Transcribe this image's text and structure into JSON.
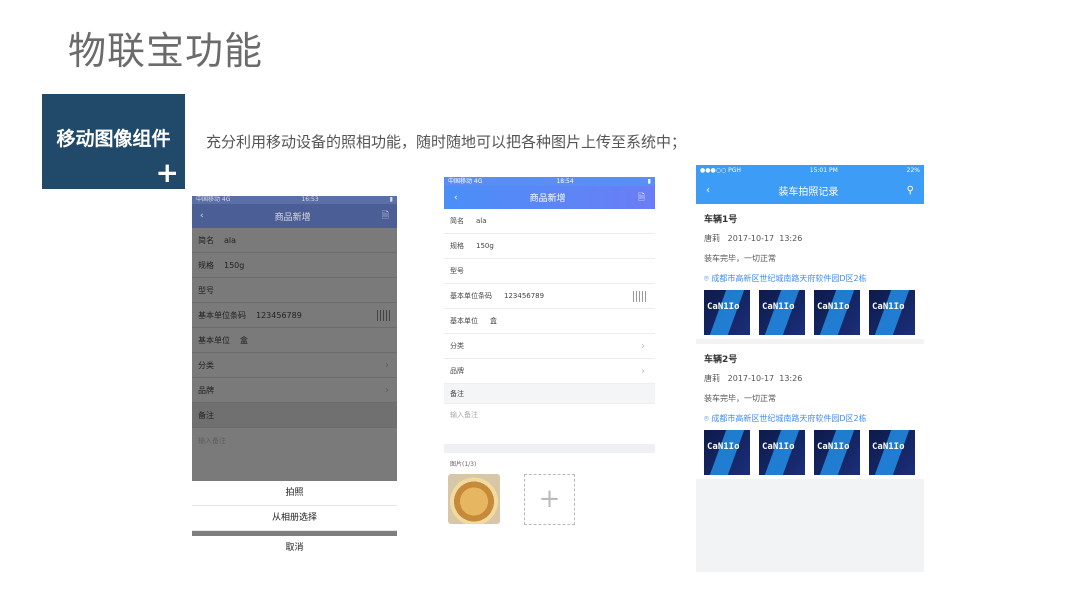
{
  "slide": {
    "title": "物联宝功能",
    "badge_label": "移动图像组件",
    "badge_plus": "+",
    "description": "充分利用移动设备的照相功能，随时随地可以把各种图片上传至系统中；"
  },
  "phone1": {
    "status": {
      "carrier": "中国移动 4G",
      "time": "16:53"
    },
    "nav": {
      "back": "‹",
      "title": "商品新增",
      "save": "🗎"
    },
    "rows": [
      {
        "label": "简名",
        "value": "ala"
      },
      {
        "label": "规格",
        "value": "150g"
      },
      {
        "label": "型号",
        "value": ""
      },
      {
        "label": "基本单位条码",
        "value": "123456789"
      },
      {
        "label": "基本单位",
        "value": "盒"
      },
      {
        "label": "分类",
        "value": ""
      },
      {
        "label": "品牌",
        "value": ""
      }
    ],
    "remark_label": "备注",
    "remark_placeholder": "输入备注",
    "sheet": {
      "camera": "拍照",
      "album": "从相册选择",
      "cancel": "取消"
    }
  },
  "phone2": {
    "status": {
      "carrier": "中国移动 4G",
      "time": "18:54"
    },
    "nav": {
      "back": "‹",
      "title": "商品新增",
      "save": "🗎"
    },
    "rows": [
      {
        "label": "简名",
        "value": "ala"
      },
      {
        "label": "规格",
        "value": "150g"
      },
      {
        "label": "型号",
        "value": ""
      },
      {
        "label": "基本单位条码",
        "value": "123456789"
      },
      {
        "label": "基本单位",
        "value": "盒"
      },
      {
        "label": "分类",
        "value": ""
      },
      {
        "label": "品牌",
        "value": ""
      }
    ],
    "remark_label": "备注",
    "remark_placeholder": "输入备注",
    "images_label": "图片(1/3)",
    "add_symbol": "+"
  },
  "phone3": {
    "status": {
      "carrier": "●●●○○ PGH",
      "time": "15:01 PM",
      "battery": "22%"
    },
    "nav": {
      "back": "‹",
      "title": "装车拍照记录",
      "filter": "⚲"
    },
    "records": [
      {
        "vehicle": "车辆1号",
        "person": "唐莉",
        "date": "2017-10-17",
        "time": "13:26",
        "note": "装车完毕，一切正常",
        "location": "成都市高新区世纪城南路天府软件园D区2栋"
      },
      {
        "vehicle": "车辆2号",
        "person": "唐莉",
        "date": "2017-10-17",
        "time": "13:26",
        "note": "装车完毕，一切正常",
        "location": "成都市高新区世纪城南路天府软件园D区2栋"
      }
    ],
    "tile_text": "CaN1Io"
  }
}
